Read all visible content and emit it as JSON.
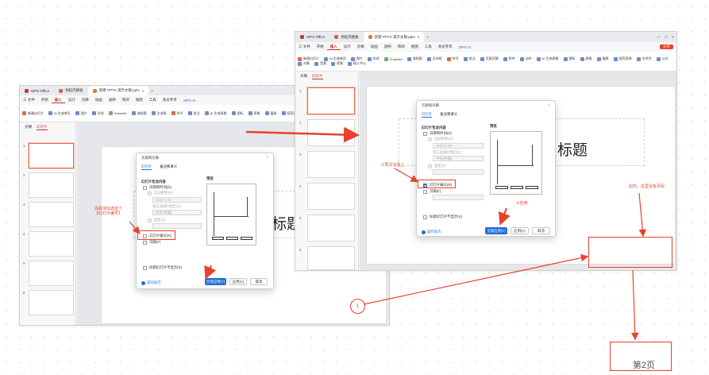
{
  "colors": {
    "accent_red": "#e8412c",
    "primary_blue": "#1f6fd1",
    "wps_red": "#c0392b"
  },
  "left_window": {
    "tabs": [
      "WPS Office",
      "找稻壳模板",
      "新建 PPTX 演示文稿.pptx"
    ],
    "menu": {
      "file": "三 文件",
      "items": [
        "开始",
        "插入",
        "设计",
        "切换",
        "动画",
        "放映",
        "审阅",
        "视图",
        "工具",
        "会员专享"
      ],
      "active": "插入",
      "ai": "WPS AI"
    },
    "ribbon": [
      "新建幻灯片",
      "AI 生成单页",
      "AI 生成表格",
      "图片",
      "形状",
      "图标",
      "表格",
      "截屏",
      "SmartArt",
      "流程图",
      "稻壳资源",
      "文本框",
      "艺术字",
      "页眉页脚",
      "公式",
      "符号",
      "批注",
      "页脚"
    ],
    "panel_tabs": [
      "大纲",
      "幻灯片"
    ],
    "slide_numbers": [
      "1",
      "2",
      "3",
      "4",
      "5",
      "6"
    ],
    "slide_title_fragment": "标题"
  },
  "right_window": {
    "tabs": [
      "WPS Office",
      "找稻壳模板",
      "新建 PPTX 演示文稿.pptx"
    ],
    "menu": {
      "file": "三 文件",
      "items": [
        "开始",
        "插入",
        "设计",
        "切换",
        "动画",
        "放映",
        "审阅",
        "视图",
        "工具",
        "会员专享"
      ],
      "active": "插入",
      "ai": "WPS AI",
      "share": "分享"
    },
    "ribbon": [
      "新建幻灯片",
      "AI 生成单页",
      "AI 生成表格",
      "图片",
      "形状",
      "图标",
      "表格",
      "截屏",
      "SmartArt",
      "流程图",
      "稻壳资源",
      "文本框",
      "艺术字",
      "页眉页脚",
      "公式",
      "符号",
      "批注",
      "页眉页脚",
      "附件",
      "动作",
      "对象",
      "幻灯片编号",
      "音频",
      "视频",
      "插入中心"
    ],
    "panel_tabs": [
      "大纲",
      "幻灯片"
    ],
    "slide_numbers": [
      "1",
      "2",
      "3",
      "4",
      "5",
      "6"
    ],
    "slide_title_fragment": "标题"
  },
  "dialog": {
    "title": "页眉和页脚",
    "tabs": [
      "幻灯片",
      "备注和讲义"
    ],
    "group_label": "幻灯片包含内容",
    "date_time": "日期和时间(D)",
    "auto_update": "自动更新(U)",
    "date_value": "2024-1-20",
    "language_label": "语言(国家/地区)(L):",
    "language_value": "中文(中国)",
    "fixed": "固定(X)",
    "slide_number": "幻灯片编号(N)",
    "footer": "页脚(F)",
    "no_title_slide": "标题幻灯片不显示(S)",
    "preview": "预览",
    "apply_all": "全部应用(Y)",
    "apply": "应用(A)",
    "cancel": "取消",
    "tips": "操作技巧"
  },
  "annotations": {
    "left_note": "先取消勾选这个\n【幻灯片编号】",
    "right_note_check": "①再次勾选上",
    "right_note_apply": "②应用",
    "right_note_now": "此时，这里没有页码",
    "circled_number": "1",
    "result_text": "第2页"
  }
}
